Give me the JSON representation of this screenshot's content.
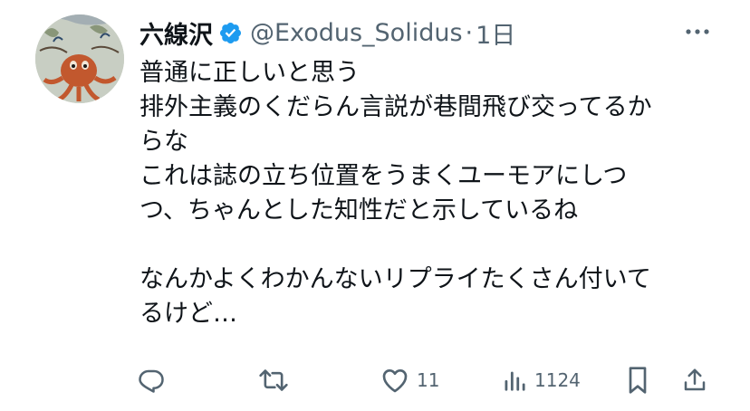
{
  "user": {
    "display_name": "六線沢",
    "handle": "@Exodus_Solidus",
    "separator": "·",
    "time": "1日"
  },
  "icons": {
    "verified": "verified-badge-icon",
    "more": "more-horizontal-icon",
    "reply": "reply-icon",
    "retweet": "retweet-icon",
    "like": "heart-icon",
    "views": "analytics-icon",
    "bookmark": "bookmark-icon",
    "share": "share-icon"
  },
  "colors": {
    "verified": "#1d9bf0",
    "secondary_text": "#536471",
    "primary_text": "#0f1419"
  },
  "tweet": {
    "lines": [
      "普通に正しいと思う",
      "排外主義のくだらん言説が巷間飛び交ってるか",
      "らな",
      "これは誌の立ち位置をうまくユーモアにしつ",
      "つ、ちゃんとした知性だと示しているね",
      "",
      "なんかよくわかんないリプライたくさん付いて",
      "るけど…"
    ]
  },
  "stats": {
    "likes": "11",
    "views": "1124"
  }
}
